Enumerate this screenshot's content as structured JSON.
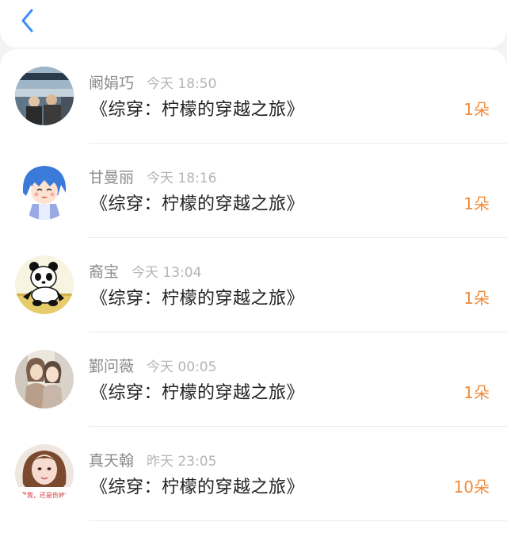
{
  "header": {
    "back_icon": "chevron-left-icon",
    "accent_color": "#3f8ef7"
  },
  "gift_list": {
    "count_color": "#f28a3a",
    "items": [
      {
        "name": "阚娟巧",
        "time": "今天 18:50",
        "book_title": "《综穿：柠檬的穿越之旅》",
        "count": "1朵"
      },
      {
        "name": "甘曼丽",
        "time": "今天 18:16",
        "book_title": "《综穿：柠檬的穿越之旅》",
        "count": "1朵"
      },
      {
        "name": "裔宝",
        "time": "今天 13:04",
        "book_title": "《综穿：柠檬的穿越之旅》",
        "count": "1朵"
      },
      {
        "name": "鄞问薇",
        "time": "今天 00:05",
        "book_title": "《综穿：柠檬的穿越之旅》",
        "count": "1朵"
      },
      {
        "name": "真天翰",
        "time": "昨天 23:05",
        "book_title": "《综穿：柠檬的穿越之旅》",
        "count": "10朵",
        "avatar_caption": "爱我，还是伤她?"
      }
    ]
  }
}
